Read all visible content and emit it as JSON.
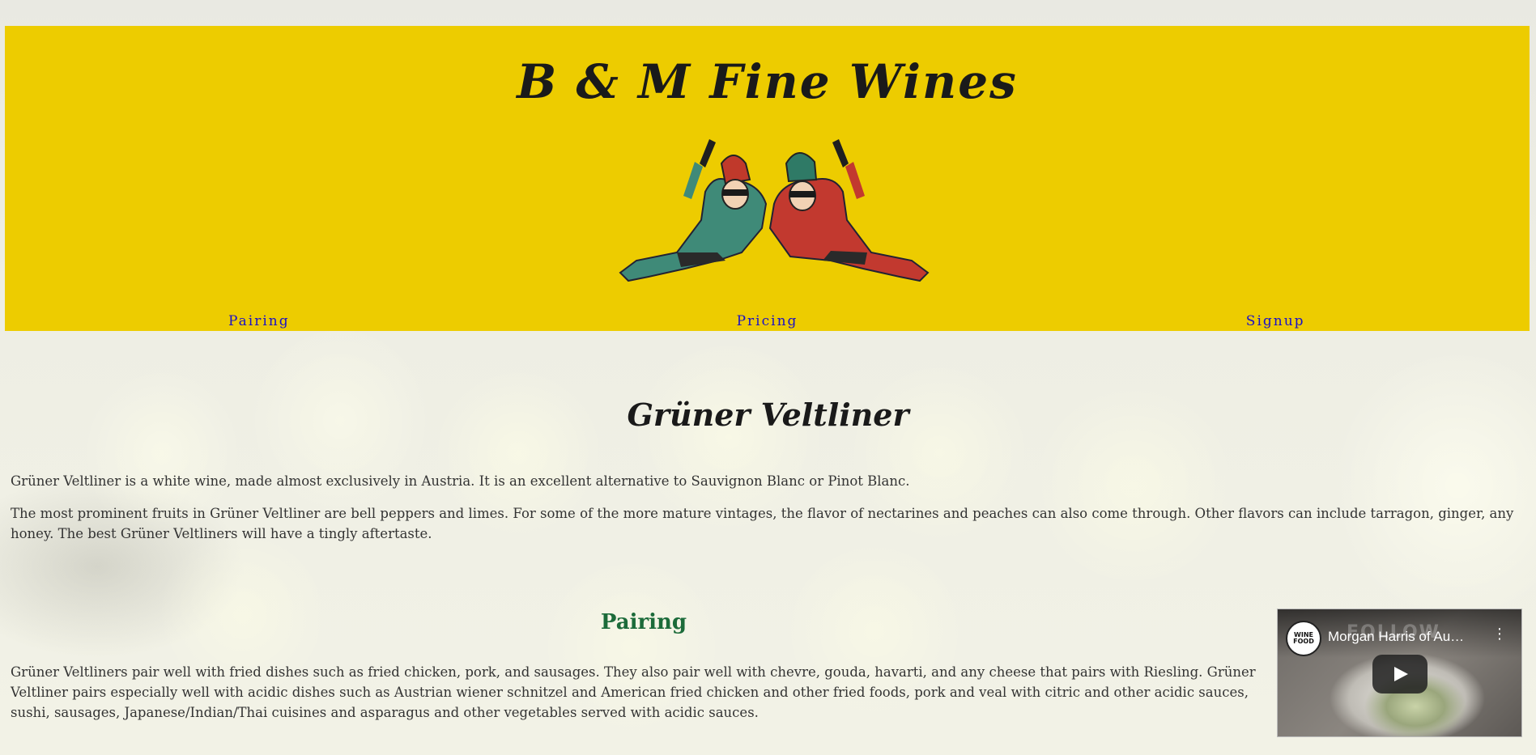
{
  "header": {
    "brand": "B & M Fine Wines",
    "logo_icon": "jester-pair-logo",
    "background_color": "#edcc00",
    "nav": [
      {
        "label": "Pairing"
      },
      {
        "label": "Pricing"
      },
      {
        "label": "Signup"
      }
    ],
    "nav_color": "#1a10c8"
  },
  "main": {
    "title": "Grüner Veltliner",
    "intro": "Grüner Veltliner is a white wine, made almost exclusively in Austria. It is an excellent alternative to Sauvignon Blanc or Pinot Blanc.",
    "flavors": "The most prominent fruits in Grüner Veltliner are bell peppers and limes. For some of the more mature vintages, the flavor of nectarines and peaches can also come through. Other flavors can include tarragon, ginger, any honey. The best Grüner Veltliners will have a tingly aftertaste."
  },
  "pairing": {
    "title": "Pairing",
    "title_color": "#1c6b3a",
    "text": "Grüner Veltliners pair well with fried dishes such as fried chicken, pork, and sausages. They also pair well with chevre, gouda, havarti, and any cheese that pairs with Riesling. Grüner Veltliner pairs especially well with acidic dishes such as Austrian wiener schnitzel and American fried chicken and other fried foods, pork and veal with citric and other acidic sauces, sushi, sausages, Japanese/Indian/Thai cuisines and asparagus and other vegetables served with acidic sauces."
  },
  "video": {
    "title": "Morgan Harris of Au…",
    "channel_logo_text": "WINE FOOD",
    "watermark": "FOLLOW",
    "menu_icon": "more-vert-icon",
    "play_icon": "play-icon"
  }
}
